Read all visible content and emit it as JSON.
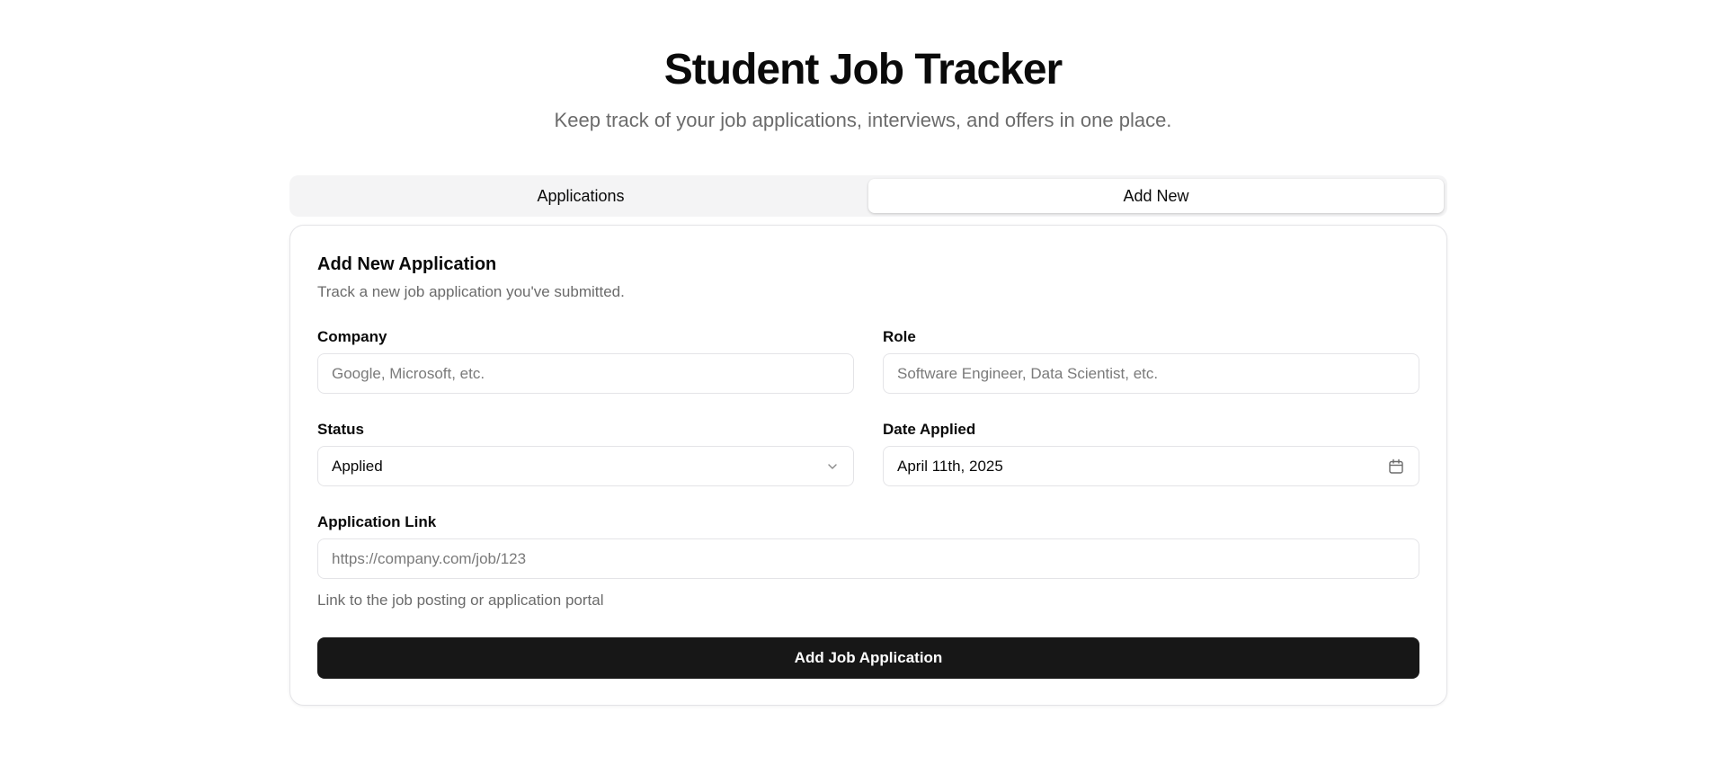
{
  "header": {
    "title": "Student Job Tracker",
    "subtitle": "Keep track of your job applications, interviews, and offers in one place."
  },
  "tabs": [
    {
      "label": "Applications",
      "active": false
    },
    {
      "label": "Add New",
      "active": true
    }
  ],
  "form": {
    "title": "Add New Application",
    "description": "Track a new job application you've submitted.",
    "company": {
      "label": "Company",
      "value": "",
      "placeholder": "Google, Microsoft, etc."
    },
    "role": {
      "label": "Role",
      "value": "",
      "placeholder": "Software Engineer, Data Scientist, etc."
    },
    "status": {
      "label": "Status",
      "selected": "Applied"
    },
    "date_applied": {
      "label": "Date Applied",
      "value": "April 11th, 2025"
    },
    "application_link": {
      "label": "Application Link",
      "value": "",
      "placeholder": "https://company.com/job/123",
      "help": "Link to the job posting or application portal"
    },
    "submit_label": "Add Job Application"
  },
  "icons": {
    "status_dropdown": "chevron-down-icon",
    "date_picker": "calendar-icon"
  },
  "colors": {
    "primary_button": "#171717",
    "muted_text": "#6b6b6b",
    "border": "#e4e4e7",
    "tab_background": "#f4f4f5"
  }
}
